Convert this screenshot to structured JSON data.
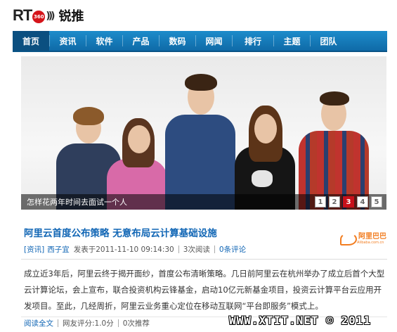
{
  "logo": {
    "text": "RT",
    "badge": "360",
    "name": "锐推"
  },
  "nav": [
    "首页",
    "资讯",
    "软件",
    "产品",
    "数码",
    "网闻",
    "排行",
    "主题",
    "团队"
  ],
  "hero": {
    "caption": "怎样花两年时间去面试一个人",
    "pages": [
      "1",
      "2",
      "3",
      "4",
      "5"
    ],
    "active_page": "3"
  },
  "article": {
    "title": "阿里云首度公布策略 无意布局云计算基础设施",
    "source_logo": "阿里巴巴",
    "source_logo_sub": "Alibaba.com.cn",
    "category": "[资讯]",
    "author": "西子宜",
    "published": "发表于2011-11-10 09:14:30",
    "views": "3次阅读",
    "comments": "0条评论",
    "body": "成立近3年后，阿里云终于揭开面纱，首度公布清晰策略。几日前阿里云在杭州举办了成立后首个大型云计算论坛，会上宣布，联合投资机构云锋基金，启动10亿元新基金项目，投资云计算平台云应用开发项目。至此，几经周折，阿里云业务重心定位在移动互联网“平台即服务”模式上。",
    "read_more": "阅读全文",
    "rating": "网友评分:1.0分",
    "recommend": "0次推荐"
  },
  "watermark": "WWW.XTIT.NET © 2011"
}
